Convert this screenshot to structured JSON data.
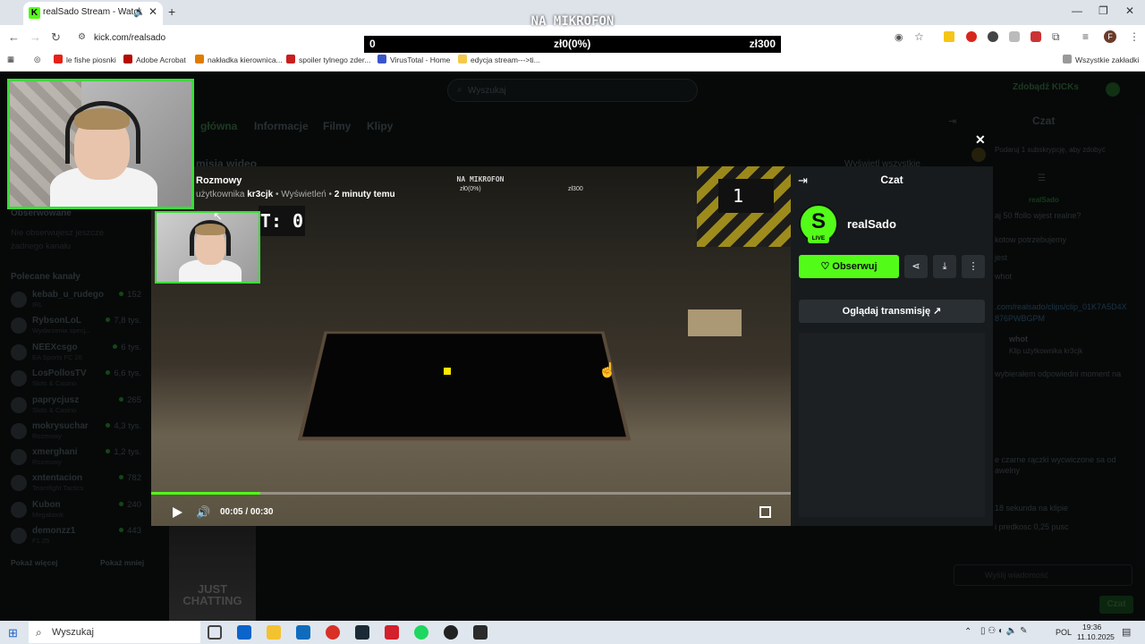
{
  "browser": {
    "tab_title": "realSado Stream - Watch Li",
    "url": "kick.com/realsado",
    "bookmarks": [
      "le fishe piosnki",
      "Adobe Acrobat",
      "nakładka kierownica...",
      "spoiler tylnego zder...",
      "VirusTotal - Home",
      "edycja stream--->ti..."
    ],
    "all_bookmarks": "Wszystkie zakładki",
    "profile_initial": "F"
  },
  "overlay": {
    "mic_title": "NA MIKROFON",
    "score_left": "0",
    "score_mid": "zł0(0%)",
    "score_right": "zł300"
  },
  "page": {
    "search_placeholder": "Wyszukaj",
    "kicks_button": "Zdobądź KICKs",
    "nav_tabs": [
      "główna",
      "Informacje",
      "Filmy",
      "Klipy"
    ],
    "section_title": "misja wideo",
    "show_all": "Wyświetl wszystkie",
    "followed_title": "Obserwowane",
    "followed_empty": "Nie obserwujesz jeszcze żadnego kanału",
    "recommended_title": "Polecane kanały",
    "channels": [
      {
        "name": "kebab_u_rudego",
        "sub": "IRL",
        "viewers": "152"
      },
      {
        "name": "RybsonLoL",
        "sub": "Wydarzenia specj...",
        "viewers": "7,8 tys."
      },
      {
        "name": "NEEXcsgo",
        "sub": "EA Sports FC 26",
        "viewers": "6 tys."
      },
      {
        "name": "LosPollosTV",
        "sub": "Slots & Casino",
        "viewers": "6,6 tys."
      },
      {
        "name": "paprycjusz",
        "sub": "Slots & Casino",
        "viewers": "265"
      },
      {
        "name": "mokrysuchar",
        "sub": "Rozmowy",
        "viewers": "4,3 tys."
      },
      {
        "name": "xmerghani",
        "sub": "Rozmowy",
        "viewers": "1,2 tys."
      },
      {
        "name": "xntentacion",
        "sub": "Teamfight Tactics",
        "viewers": "782"
      },
      {
        "name": "Kubon",
        "sub": "Megabonk",
        "viewers": "240"
      },
      {
        "name": "demonzz1",
        "sub": "F1 25",
        "viewers": "443"
      }
    ],
    "show_more": "Pokaż więcej",
    "show_less": "Pokaż mniej",
    "thumb_label": "JUST CHATTING"
  },
  "video": {
    "title": "Rozmowy",
    "meta_prefix": "użytkownika",
    "meta_user": "kr3cjk",
    "meta_views": "Wyświetleń",
    "meta_time": "2 minuty temu",
    "overlay_mic": "NA MIKROFON",
    "overlay_mid": "zł0(0%)",
    "overlay_right": "zł300",
    "score_box": "T: 0",
    "lives": "1",
    "time": "00:05 / 00:30",
    "progress": 0.17
  },
  "clip_panel": {
    "title": "Czat",
    "channel_initial": "S",
    "live": "LIVE",
    "channel_name": "realSado",
    "follow": "Obserwuj",
    "watch": "Oglądaj transmisję"
  },
  "chat": {
    "title": "Czat",
    "sub_prompt": "Podaruj 1 subskrypcję, aby zdobyć",
    "lines": [
      "realSado",
      "aj 50 ffollo wjest realne?",
      "kotow potrzebujemy",
      "jest",
      "whot",
      ".com/realsado/clips/clip_01K7A5D4X",
      "876PWBGPM",
      "whot",
      "Klip użytkownika kr3cjk",
      "wybierałem odpowiedni moment na",
      "e czarne rączki wycwiczone sa od",
      "awelny",
      "18 sekunda na klipie",
      "i predkosc 0,25 pusc"
    ],
    "input_placeholder": "Wyślij wiadomość",
    "send": "Czat"
  },
  "taskbar": {
    "search": "Wyszukaj",
    "lang": "POL",
    "time": "19:36",
    "date": "11.10.2025"
  },
  "colors": {
    "accent": "#53fc18",
    "bg": "#0b0e0f",
    "panel": "#181b1d"
  }
}
